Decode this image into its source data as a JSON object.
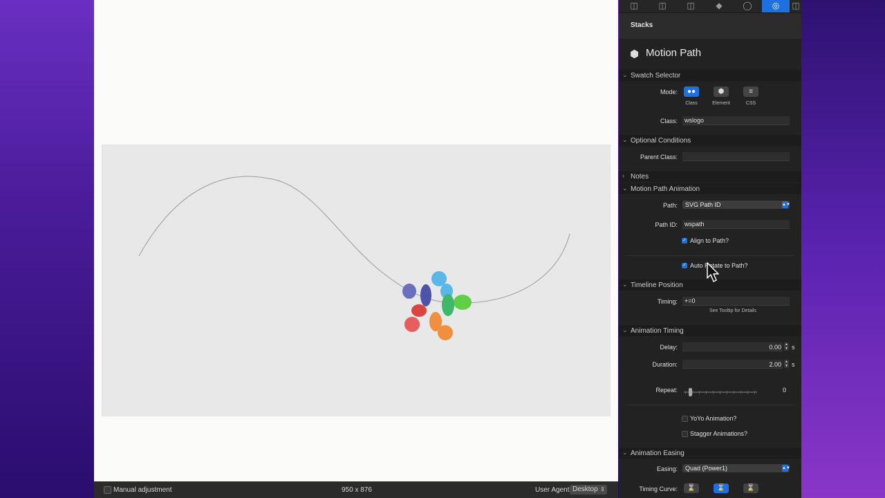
{
  "preview": {
    "status": {
      "manual_label": "Manual adjustment",
      "dimensions": "950 x 876",
      "user_agent_label": "User Agent",
      "user_agent_value": "Desktop"
    }
  },
  "inspector": {
    "tabs": [
      {
        "icon": "layout-icon"
      },
      {
        "icon": "page-icon"
      },
      {
        "icon": "columns-icon"
      },
      {
        "icon": "tag-icon"
      },
      {
        "icon": "target-icon"
      },
      {
        "icon": "gear-icon",
        "active": true
      },
      {
        "icon": "export-icon"
      }
    ],
    "stacks_title": "Stacks",
    "title": "Motion Path",
    "sections": {
      "swatch": "Swatch Selector",
      "optional": "Optional Conditions",
      "notes": "Notes",
      "motion": "Motion Path Animation",
      "timeline": "Timeline Position",
      "timing": "Animation Timing",
      "easing": "Animation Easing"
    },
    "mode": {
      "label": "Mode:",
      "options": [
        "Class",
        "Element",
        "CSS"
      ],
      "selected": "Class"
    },
    "class": {
      "label": "Class:",
      "value": "wslogo"
    },
    "parent_class": {
      "label": "Parent Class:",
      "value": ""
    },
    "path": {
      "label": "Path:",
      "value": "SVG Path ID"
    },
    "path_id": {
      "label": "Path ID:",
      "value": "wspath"
    },
    "align": {
      "label": "Align to Path?",
      "checked": true
    },
    "autorotate": {
      "label": "Auto Rotate to Path?",
      "checked": true
    },
    "timing_pos": {
      "label": "Timing:",
      "value": "+=0",
      "hint": "See Tooltip for Details"
    },
    "delay": {
      "label": "Delay:",
      "value": "0.00",
      "unit": "s"
    },
    "duration": {
      "label": "Duration:",
      "value": "2.00",
      "unit": "s"
    },
    "repeat": {
      "label": "Repeat:",
      "value": "0"
    },
    "yoyo": {
      "label": "YoYo Animation?",
      "checked": false
    },
    "stagger": {
      "label": "Stagger Animations?",
      "checked": false
    },
    "ease": {
      "label": "Easing:",
      "value": "Quad (Power1)"
    },
    "curve": {
      "label": "Timing Curve:",
      "selected": 1
    }
  },
  "colors": {
    "accent": "#1e6fe0",
    "petals": [
      "#6b6fc0",
      "#5ab8e8",
      "#3fb86a",
      "#5fcf45",
      "#f08f3c",
      "#e85d5d",
      "#d9453f",
      "#4c53a8"
    ]
  }
}
